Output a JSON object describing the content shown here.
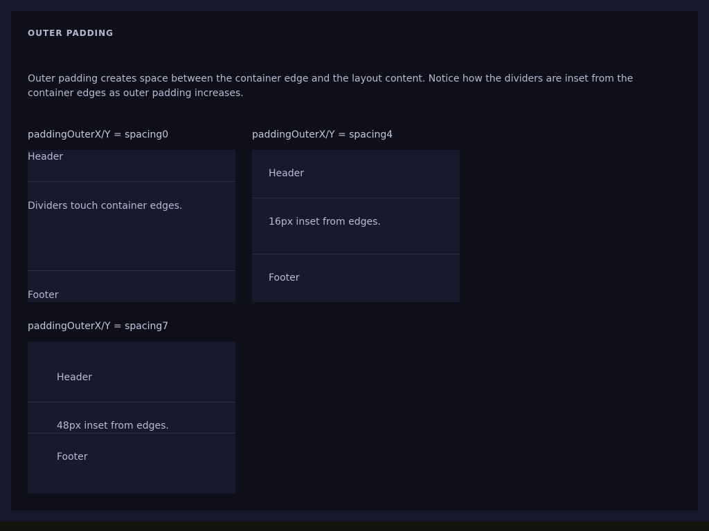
{
  "section": {
    "title": "OUTER PADDING",
    "description": "Outer padding creates space between the container edge and the layout content. Notice how the dividers are inset from the container edges as outer padding increases."
  },
  "examples": [
    {
      "label": "paddingOuterX/Y = spacing0",
      "header": "Header",
      "body": "Dividers touch container edges.",
      "footer": "Footer"
    },
    {
      "label": "paddingOuterX/Y = spacing4",
      "header": "Header",
      "body": "16px inset from edges.",
      "footer": "Footer"
    },
    {
      "label": "paddingOuterX/Y = spacing7",
      "header": "Header",
      "body": "48px inset from edges.",
      "footer": "Footer"
    }
  ],
  "colors": {
    "page_background": "#16192b",
    "panel_background": "#0f0f1a",
    "demo_background": "#161a2c",
    "divider": "#2b2f45",
    "text": "#b8bad2"
  }
}
